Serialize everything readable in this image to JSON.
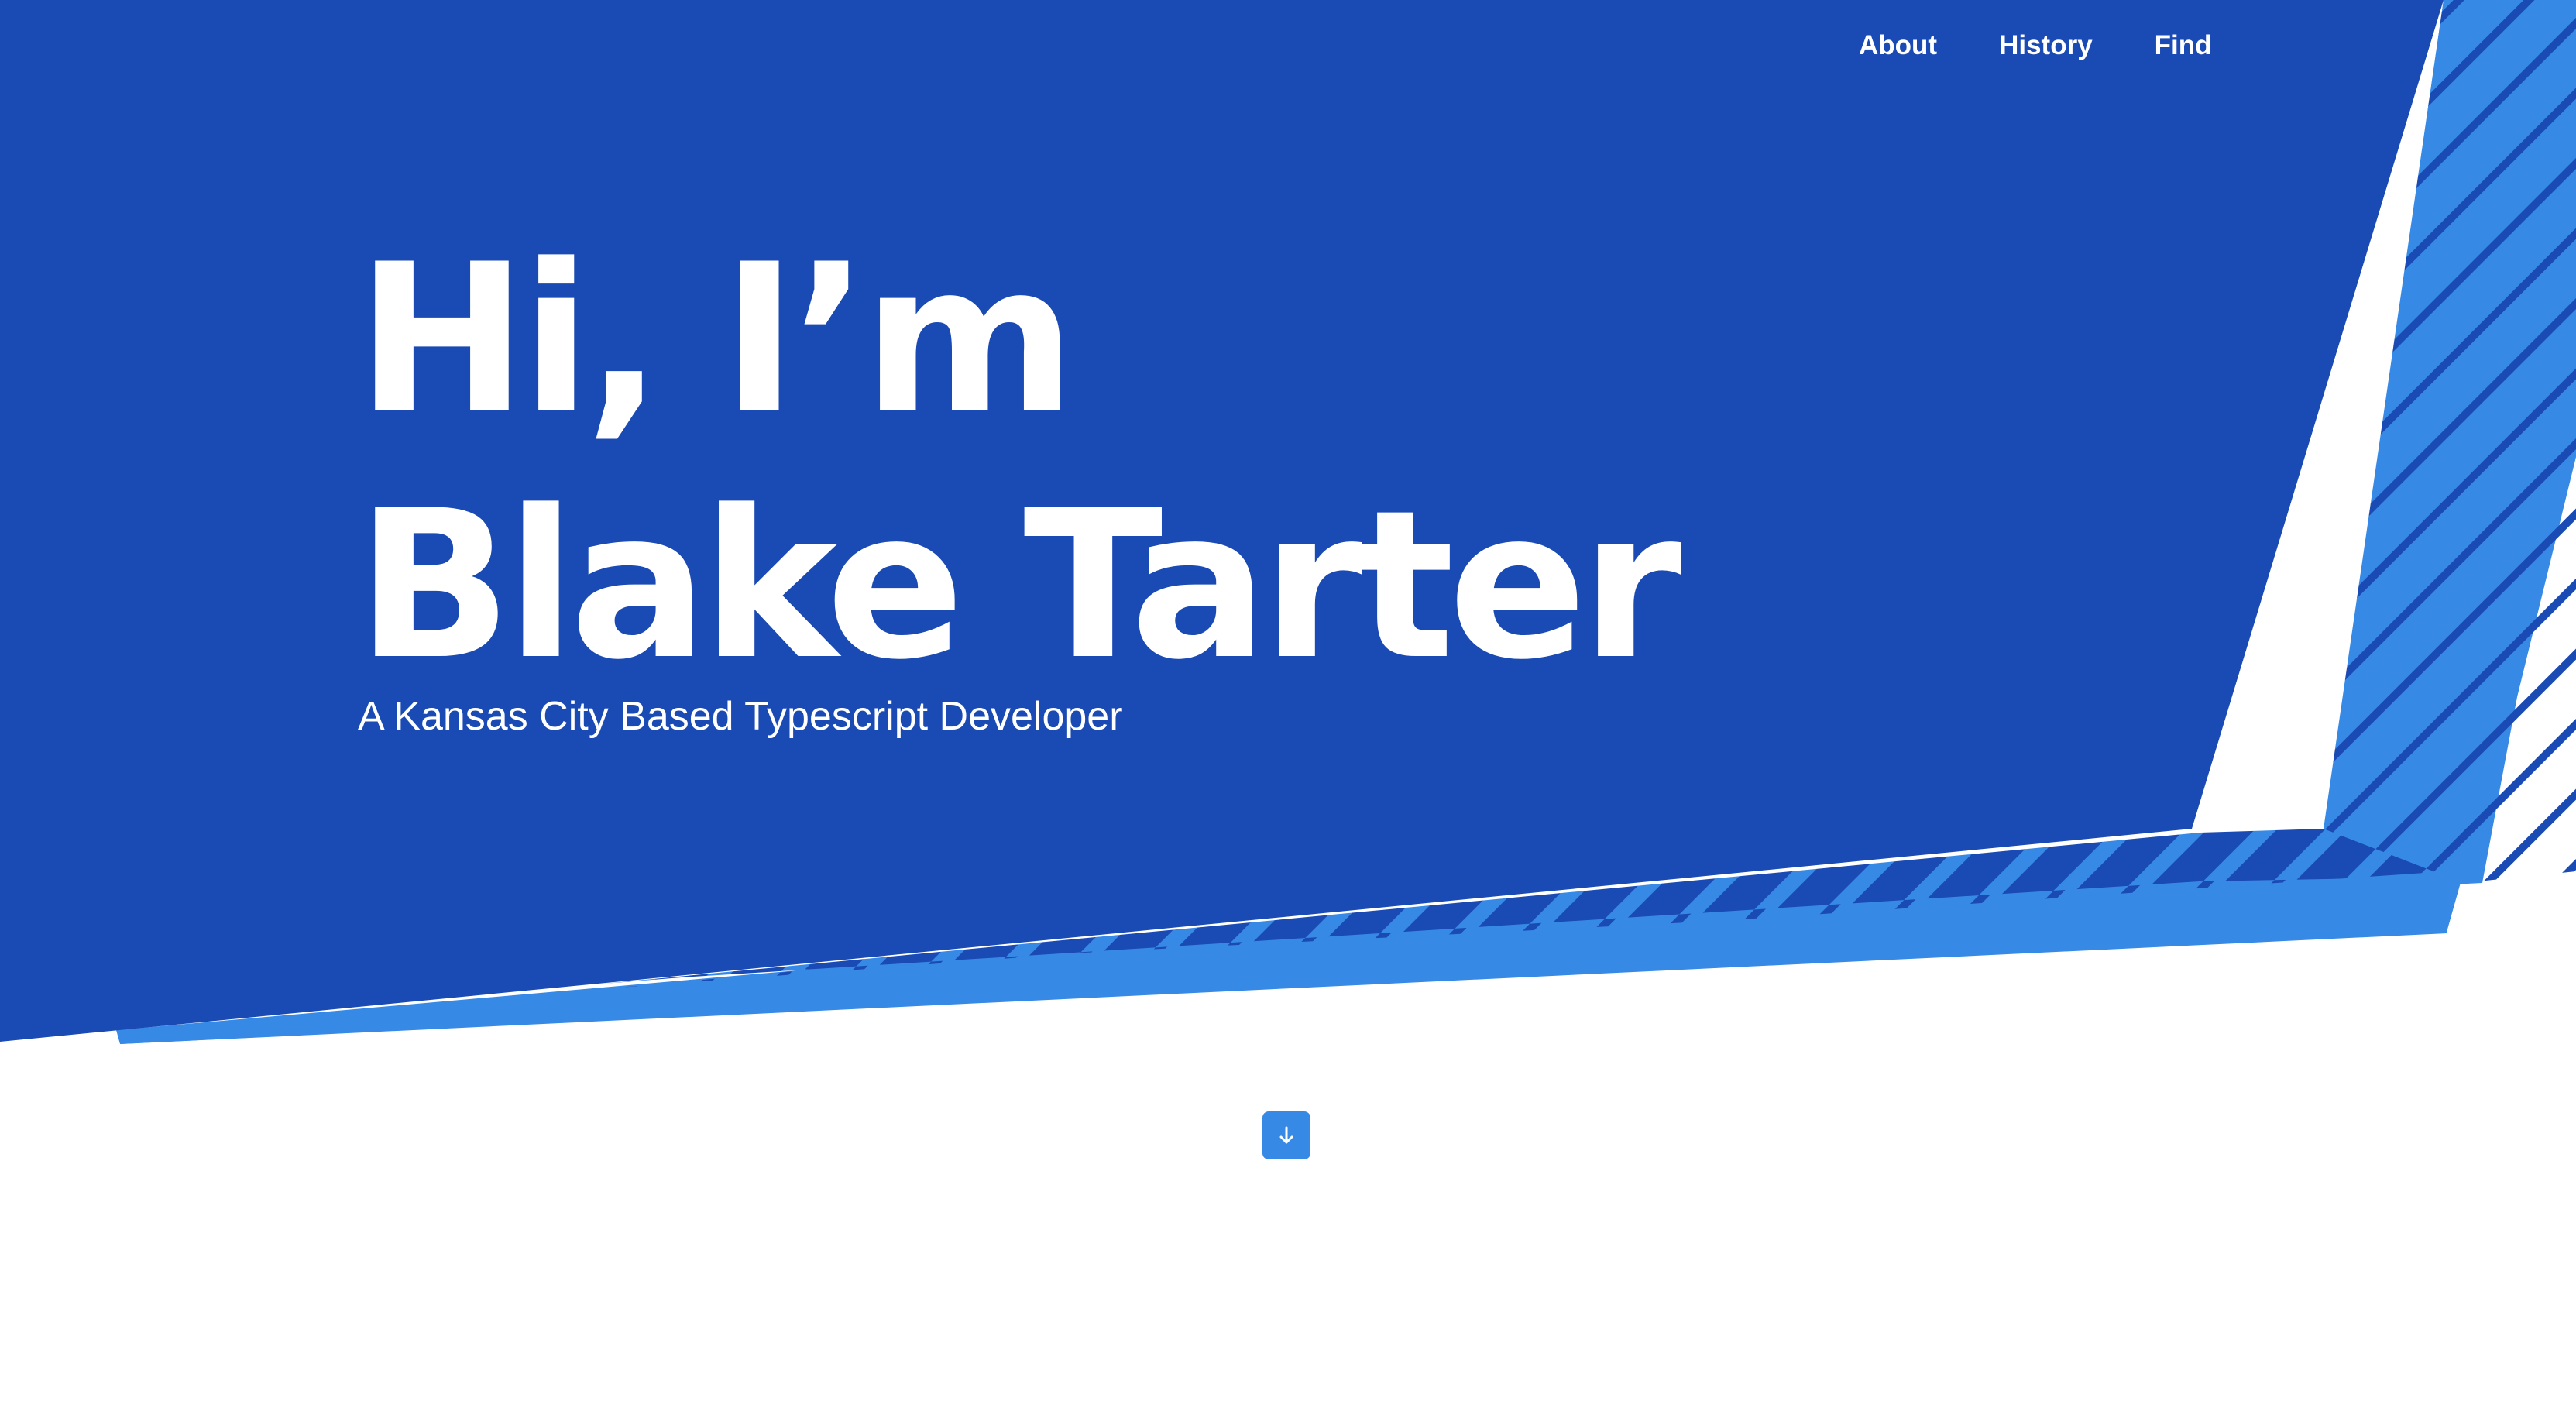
{
  "nav": {
    "links": [
      "About",
      "History",
      "Find"
    ]
  },
  "hero": {
    "title_line_1": "Hi, I’m",
    "title_line_2": "Blake Tarter",
    "subtitle": "A Kansas City Based Typescript Developer"
  },
  "scroll_button": {
    "icon": "arrow-down-icon"
  },
  "colors": {
    "primary": "#1a4ab3",
    "accent": "#3789e6",
    "text_on_primary": "#ffffff",
    "background": "#ffffff"
  }
}
